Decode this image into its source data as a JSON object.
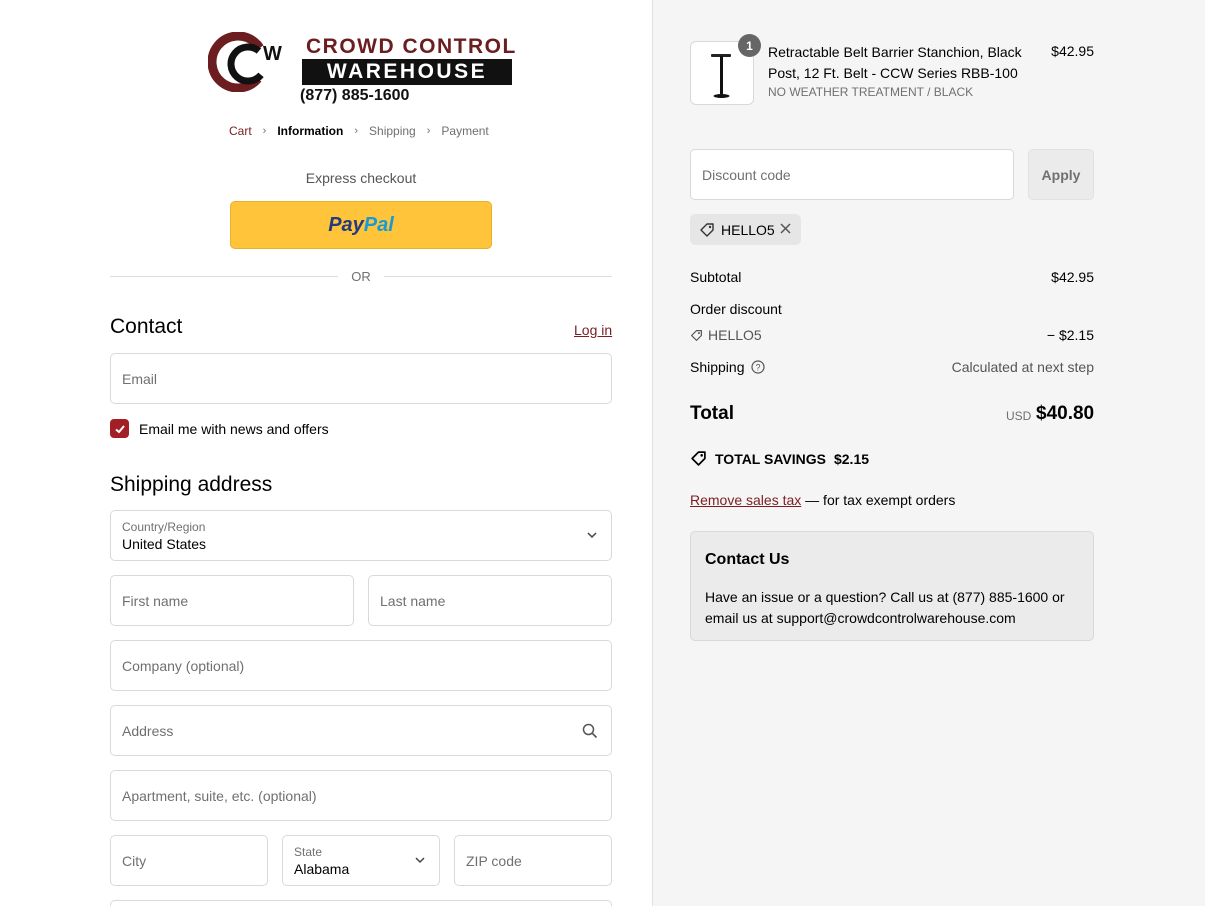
{
  "logo": {
    "line1": "CROWD CONTROL",
    "line2": "WAREHOUSE",
    "phone": "(877) 885-1600"
  },
  "breadcrumb": {
    "cart": "Cart",
    "information": "Information",
    "shipping": "Shipping",
    "payment": "Payment"
  },
  "express": {
    "label": "Express checkout",
    "paypal_part1": "Pay",
    "paypal_part2": "Pal",
    "or": "OR"
  },
  "contact": {
    "heading": "Contact",
    "login": "Log in",
    "email_placeholder": "Email",
    "newsletter_label": "Email me with news and offers",
    "newsletter_checked": true
  },
  "shipping": {
    "heading": "Shipping address",
    "country_label": "Country/Region",
    "country_value": "United States",
    "first_name": "First name",
    "last_name": "Last name",
    "company": "Company (optional)",
    "address": "Address",
    "apartment": "Apartment, suite, etc. (optional)",
    "city": "City",
    "state_label": "State",
    "state_value": "Alabama",
    "zip": "ZIP code"
  },
  "order": {
    "item": {
      "quantity": "1",
      "title": "Retractable Belt Barrier Stanchion, Black Post, 12 Ft. Belt - CCW Series RBB-100",
      "variant": "NO WEATHER TREATMENT / BLACK",
      "price": "$42.95"
    },
    "discount_placeholder": "Discount code",
    "apply_label": "Apply",
    "applied_code": "HELLO5",
    "subtotal_label": "Subtotal",
    "subtotal_value": "$42.95",
    "order_discount_label": "Order discount",
    "discount_code": "HELLO5",
    "discount_value": "− $2.15",
    "shipping_label": "Shipping",
    "shipping_value": "Calculated at next step",
    "total_label": "Total",
    "total_currency": "USD",
    "total_value": "$40.80",
    "savings_label": "TOTAL SAVINGS",
    "savings_value": "$2.15",
    "remove_tax_link": "Remove sales tax",
    "remove_tax_suffix": " — for tax exempt orders"
  },
  "contact_box": {
    "title": "Contact Us",
    "body": "Have an issue or a question? Call us at (877) 885-1600 or email us at support@crowdcontrolwarehouse.com"
  },
  "colors": {
    "accent": "#7a1e21",
    "checkbox": "#a21f25",
    "paypal_yellow": "#ffc439",
    "summary_bg": "#f5f5f5"
  }
}
